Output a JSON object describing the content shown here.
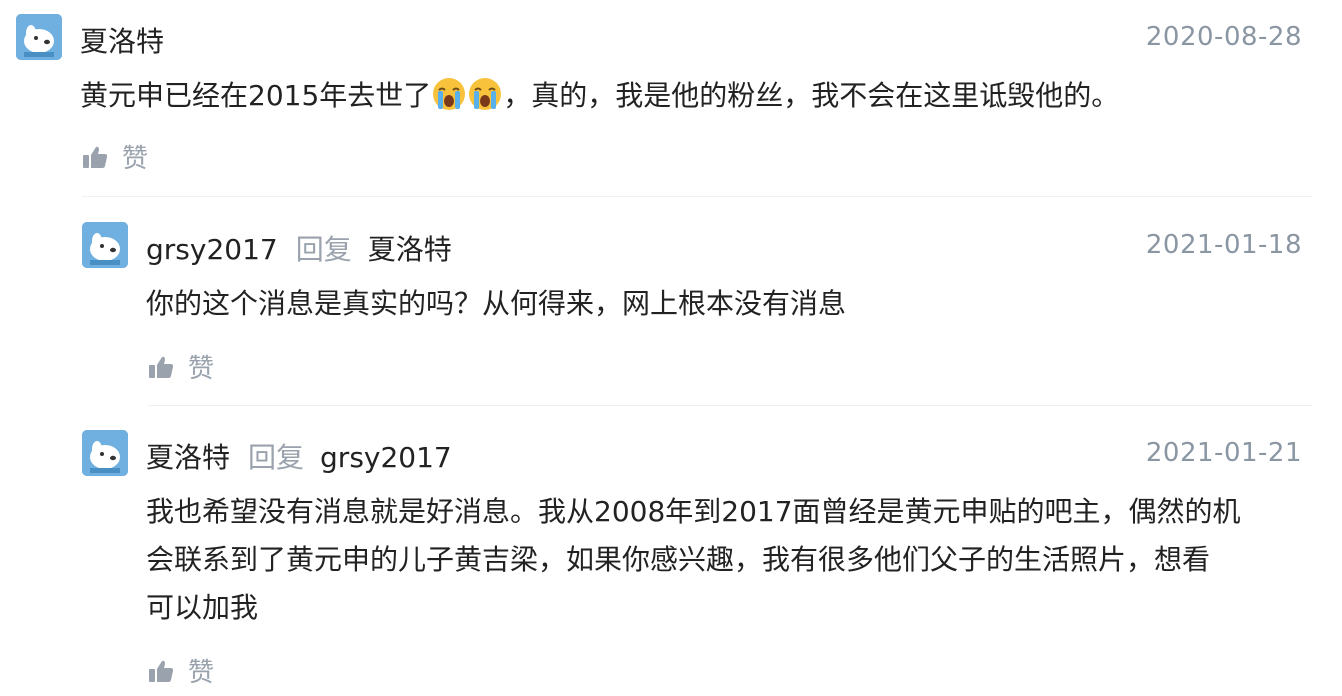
{
  "comments": [
    {
      "username": "夏洛特",
      "date": "2020-08-28",
      "text_before_emoji": "黄元申已经在2015年去世了",
      "emoji": "loudly-crying-face-icon",
      "text_after_emoji": "，真的，我是他的粉丝，我不会在这里诋毁他的。",
      "like_label": "赞"
    }
  ],
  "replies": [
    {
      "username": "grsy2017",
      "reply_word": "回复",
      "reply_to": "夏洛特",
      "date": "2021-01-18",
      "text": "你的这个消息是真实的吗？从何得来，网上根本没有消息",
      "like_label": "赞"
    },
    {
      "username": "夏洛特",
      "reply_word": "回复",
      "reply_to": "grsy2017",
      "date": "2021-01-21",
      "text_lines": [
        "我也希望没有消息就是好消息。我从2008年到2017面曾经是黄元申贴的吧主，偶然的机",
        "会联系到了黄元申的儿子黄吉梁，如果你感兴趣，我有很多他们父子的生活照片，想看",
        "可以加我"
      ],
      "like_label": "赞"
    }
  ],
  "colors": {
    "avatar_bg": "#6fb0e0",
    "meta_gray": "#8b96a3",
    "divider": "#eef0f2"
  }
}
